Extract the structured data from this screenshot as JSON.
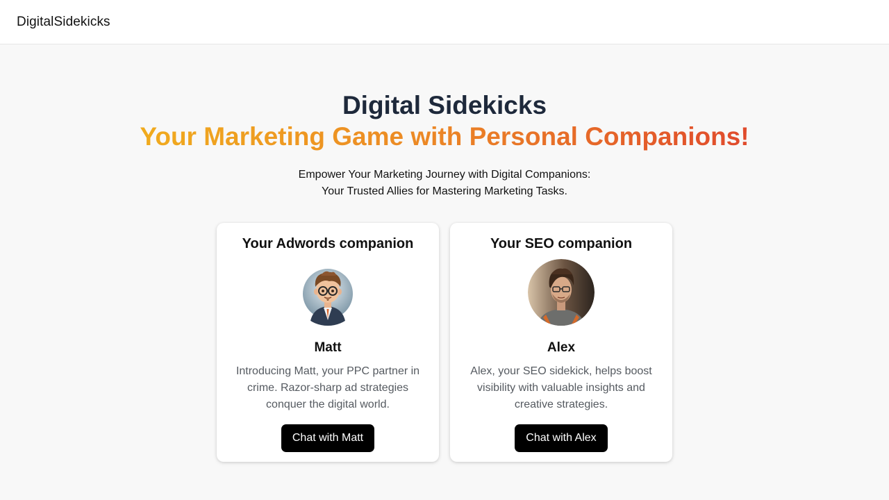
{
  "nav": {
    "brand": "DigitalSidekicks"
  },
  "hero": {
    "title": "Digital Sidekicks",
    "subtitle": "Your Marketing Game with Personal Companions!",
    "description_line1": "Empower Your Marketing Journey with Digital Companions:",
    "description_line2": "Your Trusted Allies for Mastering Marketing Tasks."
  },
  "companions": [
    {
      "heading": "Your Adwords companion",
      "name": "Matt",
      "description": "Introducing Matt, your PPC partner in crime. Razor-sharp ad strategies conquer the digital world.",
      "button_label": "Chat with Matt",
      "avatar_icon": "cartoon-man-glasses-avatar"
    },
    {
      "heading": "Your SEO companion",
      "name": "Alex",
      "description": "Alex, your SEO sidekick, helps boost visibility with valuable insights and creative strategies.",
      "button_label": "Chat with Alex",
      "avatar_icon": "photo-man-glasses-avatar"
    }
  ],
  "colors": {
    "gradient_start": "#f0ab1e",
    "gradient_end": "#e04a2c",
    "title": "#1e293b",
    "button_bg": "#000000"
  }
}
